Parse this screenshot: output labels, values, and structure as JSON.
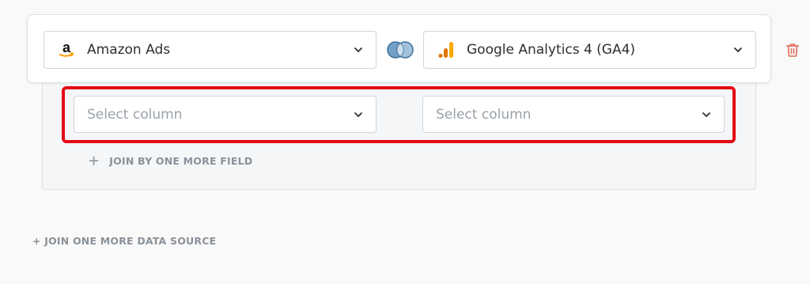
{
  "sources": {
    "left": {
      "label": "Amazon Ads",
      "icon": "amazon-logo-icon"
    },
    "right": {
      "label": "Google Analytics 4 (GA4)",
      "icon": "google-analytics-icon"
    },
    "join_icon": "venn-join-icon",
    "delete_icon": "trash-icon"
  },
  "join_fields": {
    "left_placeholder": "Select column",
    "right_placeholder": "Select column",
    "add_field_label": "JOIN BY ONE MORE FIELD",
    "add_field_icon": "+"
  },
  "footer": {
    "add_source_label": "+ JOIN ONE MORE DATA SOURCE"
  },
  "colors": {
    "highlight": "#e50914",
    "amazon_orange": "#ff9900",
    "ga_orange": "#f9ab00",
    "join_blue": "#4a86b3",
    "trash_red": "#e06a5a"
  }
}
